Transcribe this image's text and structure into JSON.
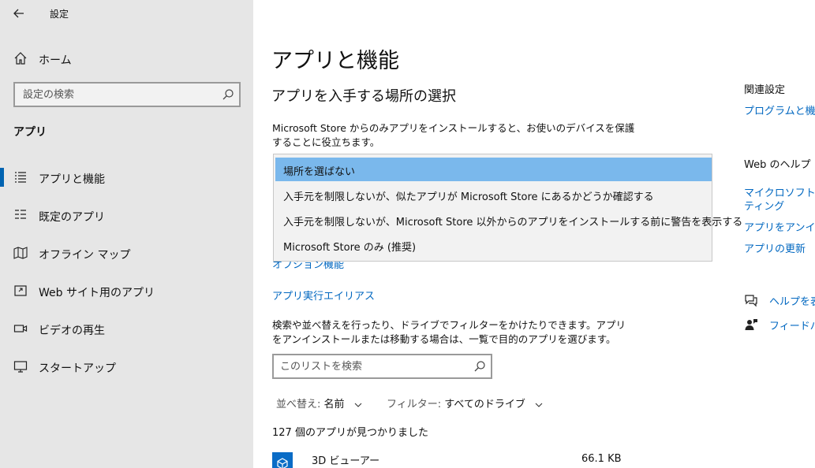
{
  "window": {
    "title": "設定",
    "back_icon": "back-arrow-icon"
  },
  "sidebar": {
    "home_label": "ホーム",
    "search_placeholder": "設定の検索",
    "section_label": "アプリ",
    "items": [
      {
        "label": "アプリと機能",
        "icon": "list-icon",
        "active": true
      },
      {
        "label": "既定のアプリ",
        "icon": "default-apps-icon",
        "active": false
      },
      {
        "label": "オフライン マップ",
        "icon": "map-icon",
        "active": false
      },
      {
        "label": "Web サイト用のアプリ",
        "icon": "web-apps-icon",
        "active": false
      },
      {
        "label": "ビデオの再生",
        "icon": "video-icon",
        "active": false
      },
      {
        "label": "スタートアップ",
        "icon": "startup-icon",
        "active": false
      }
    ]
  },
  "main": {
    "title": "アプリと機能",
    "subtitle": "アプリを入手する場所の選択",
    "description": "Microsoft Store からのみアプリをインストールすると、お使いのデバイスを保護することに役立ちます。",
    "dropdown_options": [
      "場所を選ばない",
      "入手元を制限しないが、似たアプリが Microsoft Store にあるかどうか確認する",
      "入手元を制限しないが、Microsoft Store 以外からのアプリをインストールする前に警告を表示する",
      "Microsoft Store のみ (推奨)"
    ],
    "dropdown_selected_index": 0,
    "optional_features_link": "オプション機能",
    "alias_link": "アプリ実行エイリアス",
    "list_description": "検索や並べ替えを行ったり、ドライブでフィルターをかけたりできます。アプリをアンインストールまたは移動する場合は、一覧で目的のアプリを選びます。",
    "list_search_placeholder": "このリストを検索",
    "sort_key": "並べ替え:",
    "sort_value": "名前",
    "filter_key": "フィルター:",
    "filter_value": "すべてのドライブ",
    "count_text": "127 個のアプリが見つかりました",
    "apps": [
      {
        "name": "3D ビューアー",
        "size": "66.1 KB"
      }
    ]
  },
  "right": {
    "related_head": "関連設定",
    "related_link": "プログラムと機能",
    "web_help_head": "Web のヘルプ",
    "web_links": [
      "マイクロソフト スト",
      "ティング",
      "アプリをアンインス",
      "アプリの更新"
    ],
    "help_link": "ヘルプを表",
    "feedback_link": "フィードバッ"
  },
  "colors": {
    "sidebar_bg": "#e6e6e6",
    "accent": "#0063b1",
    "link": "#0067c0",
    "dropdown_selected": "#7ab8ec"
  }
}
